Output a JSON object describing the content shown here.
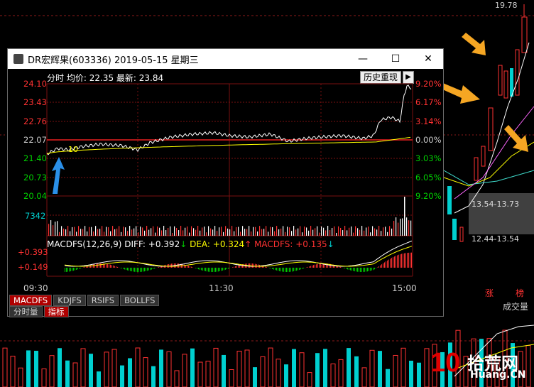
{
  "background": {
    "top_price": "19.78",
    "box1": "13.54-13.73",
    "box2": "12.44-13.54",
    "zhang_label": "涨",
    "bang_label": "榜",
    "volume_label": "成交量",
    "watermark_num": "10",
    "watermark_text": "拾荒网",
    "watermark_site": "Huang.CN"
  },
  "window": {
    "title": "DR宏辉果(603336) 2019-05-15 星期三",
    "minimize": "—",
    "maximize": "☐",
    "close": "✕"
  },
  "info": {
    "label": "分时",
    "avg_label": "均价:",
    "avg": "22.35",
    "latest_label": "最新:",
    "latest": "23.84"
  },
  "history_button": "历史重现",
  "left_prices": [
    "24.10",
    "23.43",
    "22.76",
    "22.07",
    "21.40",
    "20.73",
    "20.04"
  ],
  "right_pcts": [
    "9.20%",
    "6.17%",
    "3.14%",
    "0.00%",
    "3.03%",
    "6.05%",
    "9.20%"
  ],
  "volume_max": "7342",
  "macd": {
    "name": "MACDFS(12,26,9)",
    "diff": "DIFF: +0.392",
    "diff_arrow": "↓",
    "dea": "DEA: +0.324",
    "dea_arrow": "↑",
    "macd": "MACDFS: +0.135",
    "macd_arrow": "↓",
    "y_top": "+0.393",
    "y_mid": "+0.149"
  },
  "times": [
    "09:30",
    "11:30",
    "15:00"
  ],
  "tabs": [
    "MACDFS",
    "KDJFS",
    "RSIFS",
    "BOLLFS"
  ],
  "tabs2": [
    "分时量",
    "指标"
  ],
  "colors": {
    "up": "#ff3232",
    "down": "#00d0d0",
    "gold": "#f5a623",
    "avg": "#ffff00"
  },
  "annotation_10": "10"
}
